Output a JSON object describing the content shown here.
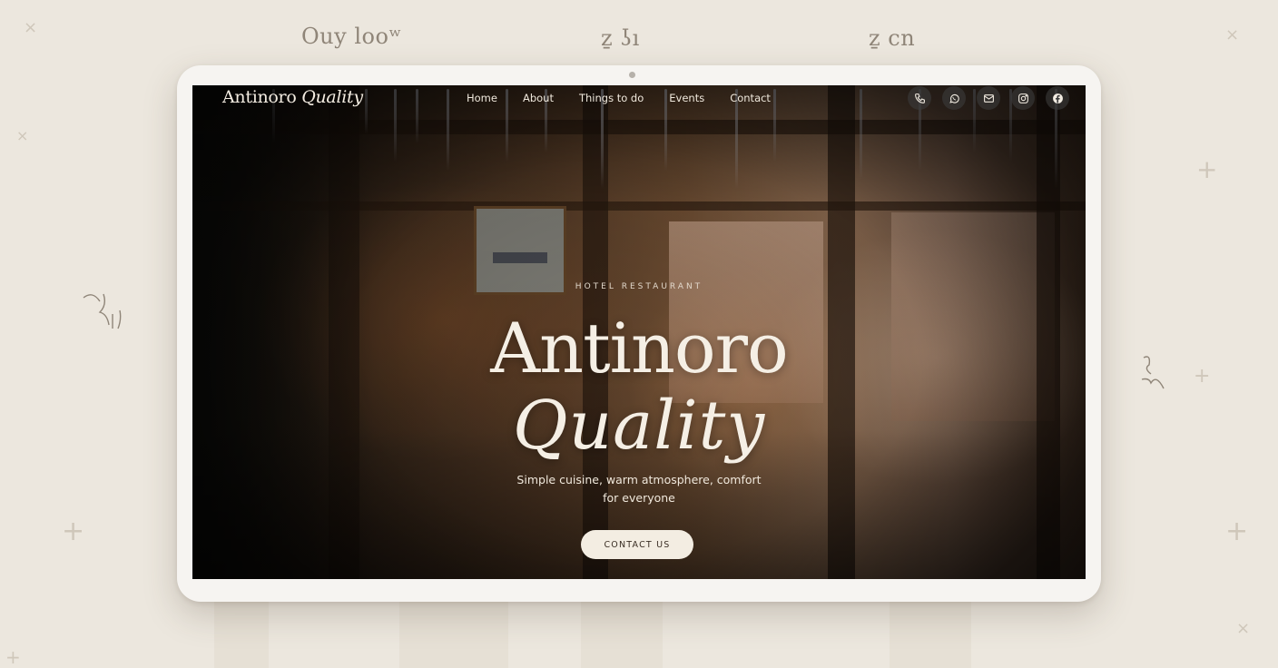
{
  "background": {
    "scribbles": [
      "Ouy looʷ",
      "ẕ ʖı",
      "ẕ cn"
    ]
  },
  "brand": {
    "name": "Antinoro",
    "script": "Quality"
  },
  "nav": {
    "items": [
      "Home",
      "About",
      "Things to do",
      "Events",
      "Contact"
    ]
  },
  "socials": [
    "phone-icon",
    "whatsapp-icon",
    "mail-icon",
    "instagram-icon",
    "facebook-icon"
  ],
  "hero": {
    "eyebrow": "HOTEL RESTAURANT",
    "title": "Antinoro",
    "title_script": "Quality",
    "tagline": "Simple cuisine, warm atmosphere, comfort for everyone",
    "cta_label": "CONTACT US"
  },
  "colors": {
    "page_bg": "#ece7de",
    "device_frame": "#f6f4f1",
    "button_bg": "#f3ede2",
    "hero_text": "#f5efe5"
  }
}
